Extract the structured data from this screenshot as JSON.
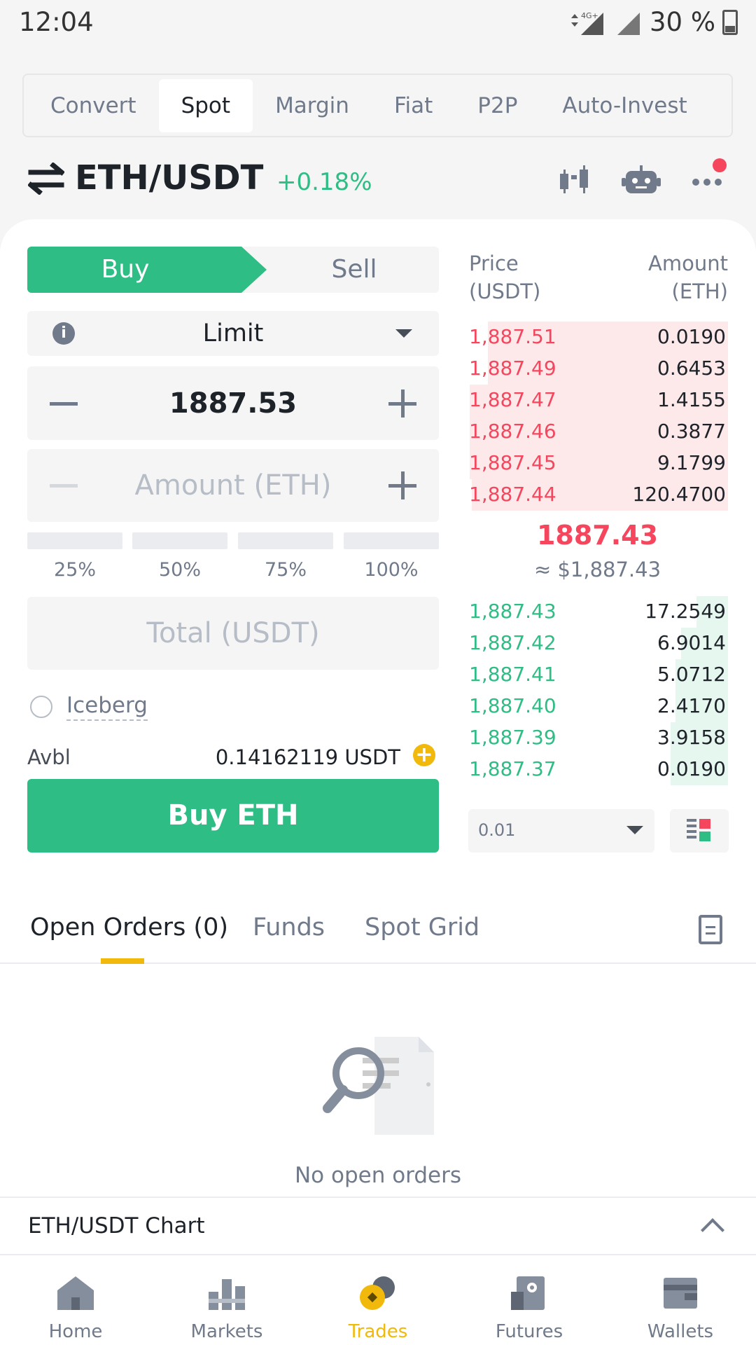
{
  "status_bar": {
    "time": "12:04",
    "network": "4G+",
    "battery": "30 %"
  },
  "mode_tabs": [
    {
      "label": "Convert",
      "active": false
    },
    {
      "label": "Spot",
      "active": true
    },
    {
      "label": "Margin",
      "active": false
    },
    {
      "label": "Fiat",
      "active": false
    },
    {
      "label": "P2P",
      "active": false
    },
    {
      "label": "Auto-Invest",
      "active": false
    }
  ],
  "pair": {
    "name": "ETH/USDT",
    "change": "+0.18%"
  },
  "order_form": {
    "buy_label": "Buy",
    "sell_label": "Sell",
    "order_type": "Limit",
    "price_value": "1887.53",
    "amount_placeholder": "Amount (ETH)",
    "percentages": [
      "25%",
      "50%",
      "75%",
      "100%"
    ],
    "total_placeholder": "Total (USDT)",
    "iceberg_label": "Iceberg",
    "avbl_label": "Avbl",
    "avbl_value": "0.14162119 USDT",
    "submit_label": "Buy ETH"
  },
  "order_book": {
    "price_header": "Price\n(USDT)",
    "price_header_l1": "Price",
    "price_header_l2": "(USDT)",
    "amount_header_l1": "Amount",
    "amount_header_l2": "(ETH)",
    "asks": [
      {
        "price": "1,887.51",
        "amount": "0.0190",
        "depth": 0.92
      },
      {
        "price": "1,887.49",
        "amount": "0.6453",
        "depth": 0.92
      },
      {
        "price": "1,887.47",
        "amount": "1.4155",
        "depth": 0.99
      },
      {
        "price": "1,887.46",
        "amount": "0.3877",
        "depth": 0.99
      },
      {
        "price": "1,887.45",
        "amount": "9.1799",
        "depth": 0.99
      },
      {
        "price": "1,887.44",
        "amount": "120.4700",
        "depth": 0.98
      }
    ],
    "last_price": "1887.43",
    "last_price_usd": "≈ $1,887.43",
    "bids": [
      {
        "price": "1,887.43",
        "amount": "17.2549",
        "depth": 0.12
      },
      {
        "price": "1,887.42",
        "amount": "6.9014",
        "depth": 0.18
      },
      {
        "price": "1,887.41",
        "amount": "5.0712",
        "depth": 0.2
      },
      {
        "price": "1,887.40",
        "amount": "2.4170",
        "depth": 0.2
      },
      {
        "price": "1,887.39",
        "amount": "3.9158",
        "depth": 0.22
      },
      {
        "price": "1,887.37",
        "amount": "0.0190",
        "depth": 0.22
      }
    ],
    "precision": "0.01"
  },
  "orders_tabs": [
    {
      "label": "Open Orders (0)",
      "active": true
    },
    {
      "label": "Funds",
      "active": false
    },
    {
      "label": "Spot Grid",
      "active": false
    }
  ],
  "empty_state": "No open orders",
  "chart_label": "ETH/USDT Chart",
  "bottom_nav": [
    {
      "label": "Home",
      "icon": "home-icon",
      "active": false
    },
    {
      "label": "Markets",
      "icon": "markets-icon",
      "active": false
    },
    {
      "label": "Trades",
      "icon": "trades-icon",
      "active": true
    },
    {
      "label": "Futures",
      "icon": "futures-icon",
      "active": false
    },
    {
      "label": "Wallets",
      "icon": "wallets-icon",
      "active": false
    }
  ],
  "colors": {
    "buy": "#2ebd85",
    "sell": "#f6465d",
    "accent": "#f0b90b"
  }
}
